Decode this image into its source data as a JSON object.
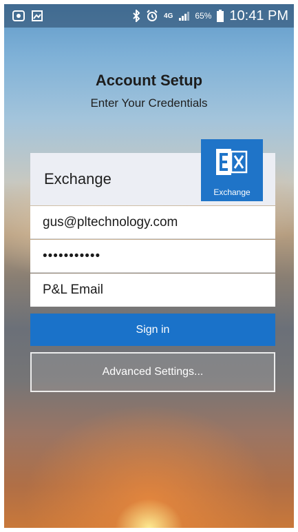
{
  "status_bar": {
    "left_icons": [
      "data-saver-icon",
      "gallery-notification-icon"
    ],
    "right_icons": [
      "bluetooth-icon",
      "alarm-icon",
      "4g-lte-icon",
      "signal-icon",
      "battery-icon"
    ],
    "network_label": "4G",
    "battery_percent": "65%",
    "time": "10:41 PM"
  },
  "header": {
    "title": "Account Setup",
    "subtitle": "Enter Your Credentials"
  },
  "account": {
    "type_label": "Exchange",
    "logo_label": "Exchange",
    "logo_icon": "exchange-logo-icon",
    "logo_color": "#1f74c8"
  },
  "form": {
    "email": "gus@pltechnology.com",
    "password": "•••••••••••",
    "description": "P&L Email"
  },
  "buttons": {
    "sign_in": "Sign in",
    "advanced_settings": "Advanced Settings..."
  },
  "colors": {
    "accent": "#1a72c9",
    "card_header": "#eceef4"
  }
}
